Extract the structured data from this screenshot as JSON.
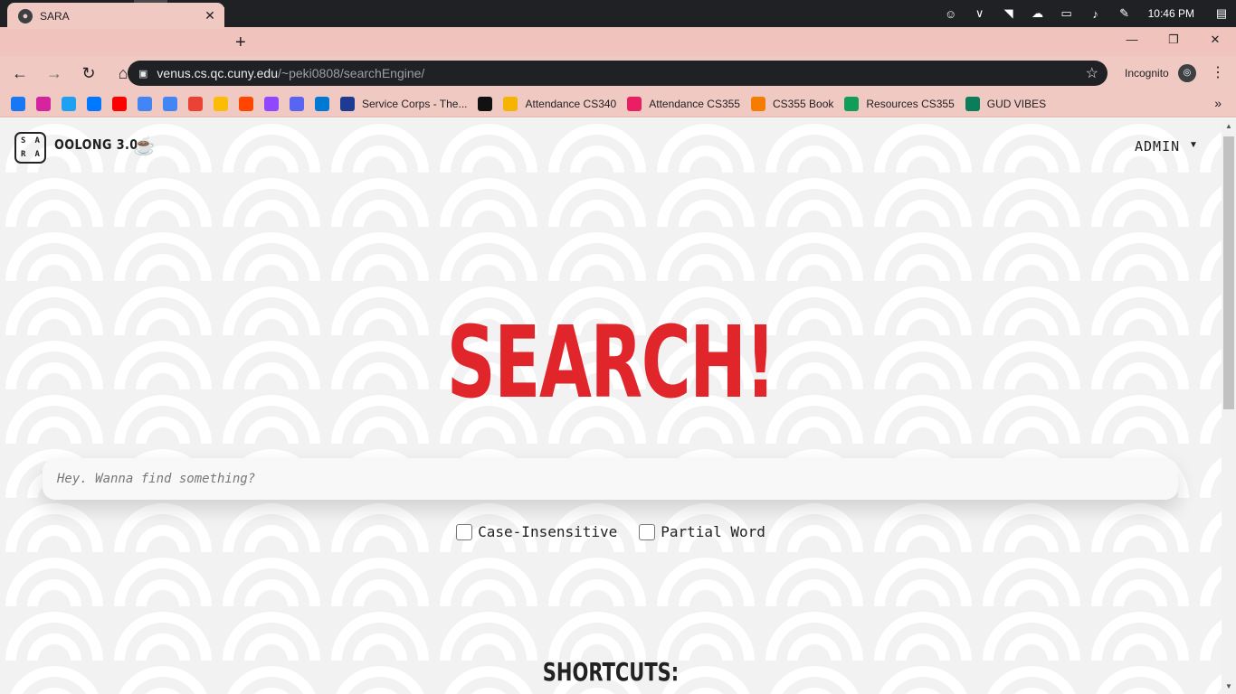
{
  "taskbar": {
    "icons": [
      "windows-icon",
      "cortana-icon",
      "task-view-icon",
      "spotify-icon",
      "chrome-icon",
      "file-explorer-icon",
      "sticky-notes-icon"
    ],
    "clock": "10:46 PM"
  },
  "browser": {
    "tab_title": "SARA",
    "url_host": "venus.cs.qc.cuny.edu",
    "url_path": "/~peki0808/searchEngine/",
    "incognito_label": "Incognito",
    "bookmarks": [
      {
        "icon": "facebook-icon",
        "label": "",
        "color": "#1877f2"
      },
      {
        "icon": "instagram-icon",
        "label": "",
        "color": "#d6249f"
      },
      {
        "icon": "twitter-icon",
        "label": "",
        "color": "#1da1f2"
      },
      {
        "icon": "messenger-icon",
        "label": "",
        "color": "#0078ff"
      },
      {
        "icon": "youtube-icon",
        "label": "",
        "color": "#ff0000"
      },
      {
        "icon": "docs-icon",
        "label": "",
        "color": "#4285f4"
      },
      {
        "icon": "calendar-icon",
        "label": "",
        "color": "#4285f4"
      },
      {
        "icon": "gmail-icon",
        "label": "",
        "color": "#ea4335"
      },
      {
        "icon": "photos-icon",
        "label": "",
        "color": "#fbbc05"
      },
      {
        "icon": "reddit-icon",
        "label": "",
        "color": "#ff4500"
      },
      {
        "icon": "twitch-icon",
        "label": "",
        "color": "#9146ff"
      },
      {
        "icon": "discord-icon",
        "label": "",
        "color": "#5865f2"
      },
      {
        "icon": "outlook-icon",
        "label": "",
        "color": "#0078d4"
      },
      {
        "icon": "service-corps-icon",
        "label": "Service Corps - The...",
        "color": "#1f3a93"
      },
      {
        "icon": "quizlet-icon",
        "label": "",
        "color": "#111111"
      },
      {
        "icon": "attendance-icon",
        "label": "Attendance CS340",
        "color": "#f4b400"
      },
      {
        "icon": "attendance-t-icon",
        "label": "Attendance CS355",
        "color": "#e91e63"
      },
      {
        "icon": "zybooks-icon",
        "label": "CS355 Book",
        "color": "#f57c00"
      },
      {
        "icon": "drive-icon",
        "label": "Resources CS355",
        "color": "#0f9d58"
      },
      {
        "icon": "gud-vibes-icon",
        "label": "GUD VIBES",
        "color": "#0a7d5a"
      }
    ]
  },
  "app": {
    "logo_letters": [
      "S",
      "A",
      "R",
      "A"
    ],
    "brand": "OOLONG 3.0",
    "user_menu": "ADMIN",
    "hero_title": "SEARCH!",
    "search_placeholder": "Hey. Wanna find something?",
    "options": [
      "Case-Insensitive",
      "Partial Word"
    ],
    "shortcuts_heading": "SHORTCUTS:"
  },
  "colors": {
    "accent": "#e0262a",
    "chrome_frame": "#f1c9c3",
    "omnibox": "#202124"
  }
}
